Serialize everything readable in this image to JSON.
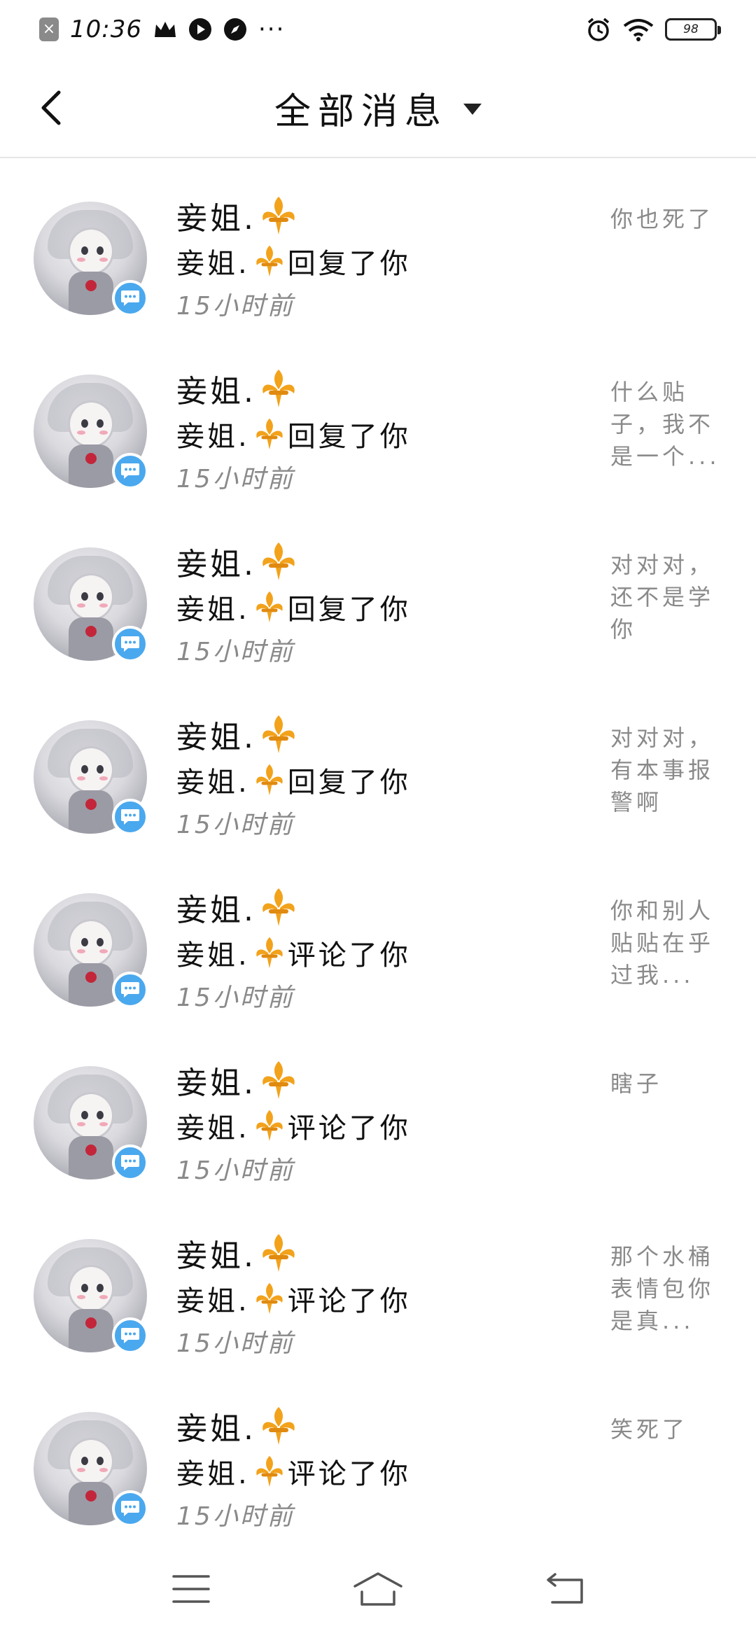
{
  "status_bar": {
    "time": "10:36",
    "battery": "98"
  },
  "header": {
    "title": "全部消息"
  },
  "messages": [
    {
      "name": "妾姐.",
      "action_name": "妾姐.",
      "action": "回复了你",
      "time": "15小时前",
      "preview": "你也死了"
    },
    {
      "name": "妾姐.",
      "action_name": "妾姐.",
      "action": "回复了你",
      "time": "15小时前",
      "preview": "什么贴子，我不是一个..."
    },
    {
      "name": "妾姐.",
      "action_name": "妾姐.",
      "action": "回复了你",
      "time": "15小时前",
      "preview": "对对对，还不是学你"
    },
    {
      "name": "妾姐.",
      "action_name": "妾姐.",
      "action": "回复了你",
      "time": "15小时前",
      "preview": "对对对，有本事报警啊"
    },
    {
      "name": "妾姐.",
      "action_name": "妾姐.",
      "action": "评论了你",
      "time": "15小时前",
      "preview": "你和别人贴贴在乎过我..."
    },
    {
      "name": "妾姐.",
      "action_name": "妾姐.",
      "action": "评论了你",
      "time": "15小时前",
      "preview": "瞎子"
    },
    {
      "name": "妾姐.",
      "action_name": "妾姐.",
      "action": "评论了你",
      "time": "15小时前",
      "preview": "那个水桶表情包你是真..."
    },
    {
      "name": "妾姐.",
      "action_name": "妾姐.",
      "action": "评论了你",
      "time": "15小时前",
      "preview": "笑死了"
    }
  ],
  "icons": {
    "back": "chevron-left-icon",
    "dropdown": "caret-down-icon",
    "name_emoji": "fleur-de-lis-icon",
    "avatar_badge": "chat-bubble-icon",
    "nav_menu": "menu-icon",
    "nav_home": "home-icon",
    "nav_back": "return-icon"
  },
  "colors": {
    "badge": "#4aa8ee",
    "fleur": "#f2a21b",
    "muted_text": "#8a8a8a"
  }
}
